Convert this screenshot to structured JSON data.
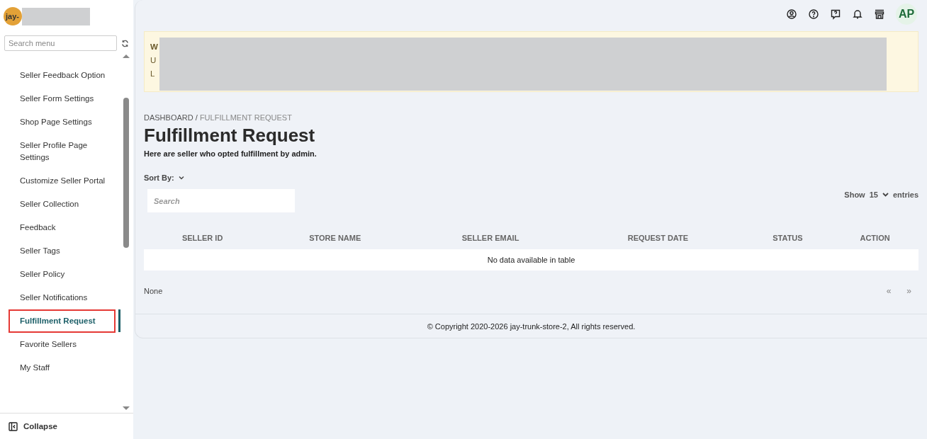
{
  "sidebar": {
    "store_initials": "jay-",
    "search": {
      "placeholder": "Search menu"
    },
    "items": [
      {
        "label": "Seller Feedback Option",
        "selected": false
      },
      {
        "label": "Seller Form Settings",
        "selected": false
      },
      {
        "label": "Shop Page Settings",
        "selected": false
      },
      {
        "label": "Seller Profile Page Settings",
        "selected": false
      },
      {
        "label": "Customize Seller Portal",
        "selected": false
      },
      {
        "label": "Seller Collection",
        "selected": false
      },
      {
        "label": "Feedback",
        "selected": false
      },
      {
        "label": "Seller Tags",
        "selected": false
      },
      {
        "label": "Seller Policy",
        "selected": false
      },
      {
        "label": "Seller Notifications",
        "selected": false
      },
      {
        "label": "Fulfillment Request",
        "selected": true
      },
      {
        "label": "Favorite Sellers",
        "selected": false
      },
      {
        "label": "My Staff",
        "selected": false
      }
    ],
    "collapse": "Collapse"
  },
  "topbar": {
    "avatar": "AP"
  },
  "banner": {
    "lines": [
      "W",
      "U",
      "L"
    ]
  },
  "breadcrumb": {
    "root": "DASHBOARD",
    "separator": "/",
    "current": "FULFILLMENT REQUEST"
  },
  "title": "Fulfillment Request",
  "subtitle": "Here are seller who opted fulfillment by admin.",
  "sort_by": "Sort By:",
  "search": {
    "placeholder": "Search"
  },
  "entries": {
    "show": "Show",
    "value": "15",
    "suffix": "entries"
  },
  "table": {
    "columns": [
      "SELLER ID",
      "STORE NAME",
      "SELLER EMAIL",
      "REQUEST DATE",
      "STATUS",
      "ACTION"
    ],
    "empty": "No data available in table"
  },
  "table_info": "None",
  "pagination": {
    "prev": "«",
    "next": "»"
  },
  "footer": "© Copyright 2020-2026 jay-trunk-store-2, All rights reserved."
}
